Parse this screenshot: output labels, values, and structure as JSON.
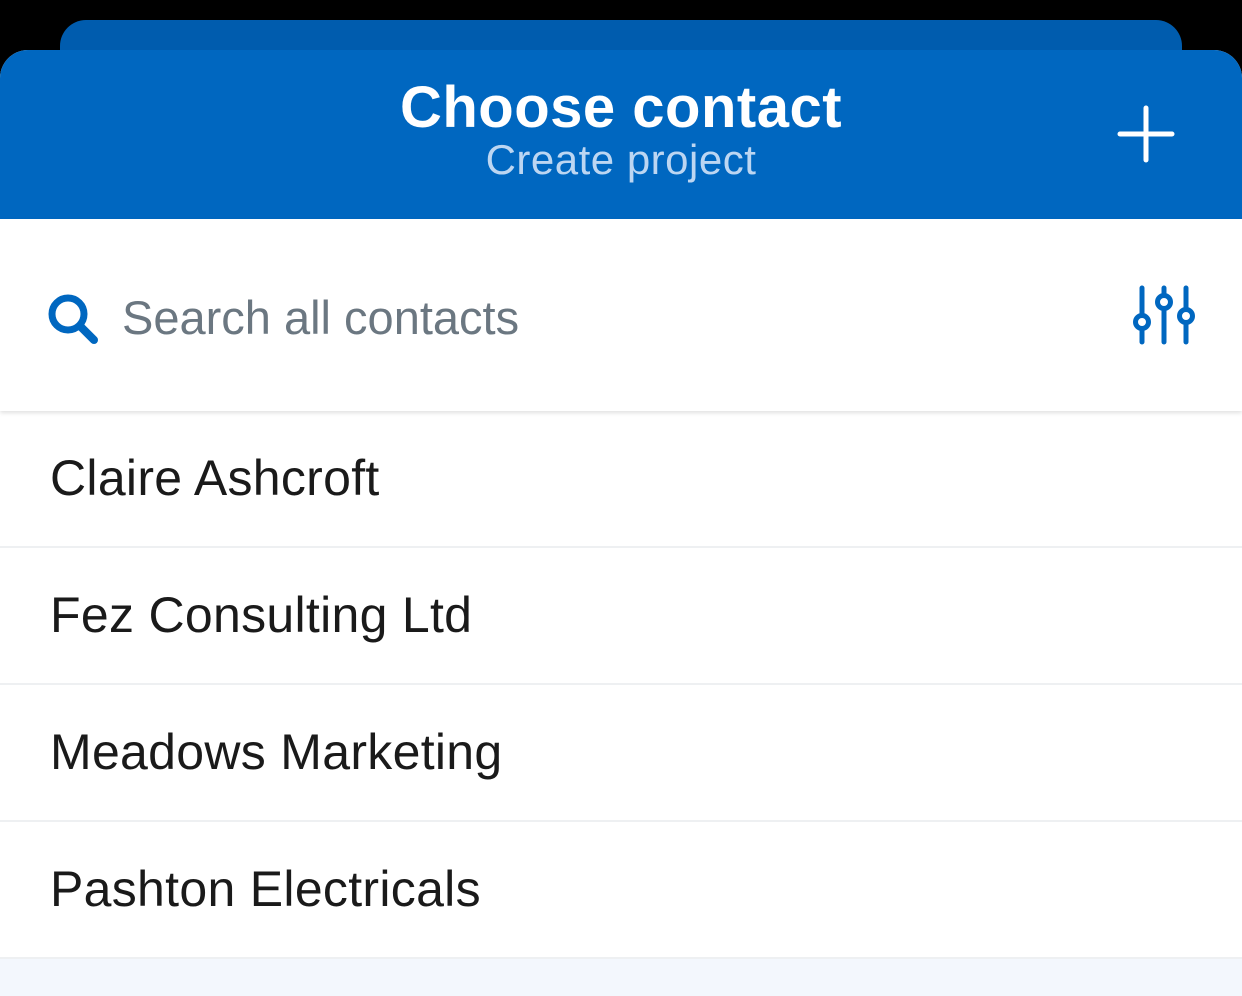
{
  "header": {
    "title": "Choose contact",
    "subtitle": "Create project",
    "add_icon": "plus-icon"
  },
  "search": {
    "placeholder": "Search all contacts",
    "value": "",
    "search_icon": "search-icon",
    "filter_icon": "sliders-icon"
  },
  "contacts": [
    {
      "name": "Claire Ashcroft"
    },
    {
      "name": "Fez Consulting Ltd"
    },
    {
      "name": "Meadows Marketing"
    },
    {
      "name": "Pashton Electricals"
    }
  ],
  "colors": {
    "header_bg": "#0067c0",
    "back_card": "#005cae",
    "accent": "#0067c0",
    "subtitle": "#bcd6f2",
    "list_bg": "#f3f7fd"
  }
}
